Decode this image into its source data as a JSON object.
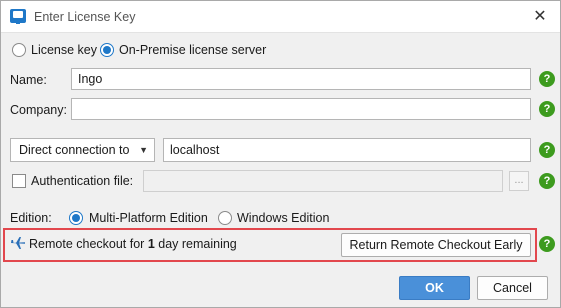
{
  "window": {
    "title": "Enter License Key"
  },
  "license_mode": {
    "license_key_label": "License key",
    "server_label": "On-Premise license server",
    "selected": "server"
  },
  "fields": {
    "name_label": "Name:",
    "name_value": "Ingo",
    "company_label": "Company:",
    "company_value": ""
  },
  "connection": {
    "mode_selected": "Direct connection to",
    "host_value": "localhost",
    "auth_label": "Authentication file:",
    "auth_checked": false,
    "auth_value": "",
    "browse_label": "..."
  },
  "edition": {
    "label": "Edition:",
    "multi_platform_label": "Multi-Platform Edition",
    "windows_label": "Windows Edition",
    "selected": "multi_platform"
  },
  "remote_checkout": {
    "text_prefix": "Remote checkout for ",
    "days": "1",
    "text_suffix": " day remaining",
    "return_button_label": "Return Remote Checkout Early",
    "highlight_color": "#e2474d"
  },
  "footer": {
    "ok_label": "OK",
    "cancel_label": "Cancel"
  },
  "help_symbol": "?",
  "colors": {
    "accent": "#1f78c8",
    "help_green": "#3d9b1e",
    "primary_button": "#4a90d9"
  }
}
